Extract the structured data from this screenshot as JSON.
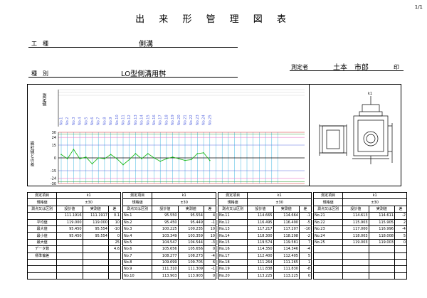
{
  "page_number": "1/1",
  "title": "出 来 形 管 理 図 表",
  "header": {
    "work_label": "工　種",
    "work_value": "側溝",
    "type_label": "種　別",
    "type_value": "LO型側溝用桝",
    "measurer_label": "測定者",
    "measurer_name": "土本　市郎",
    "seal_label": "印"
  },
  "chart": {
    "measured_label": "測定値",
    "diff_label": "設計値との差",
    "points": [
      "No.1",
      "No.2",
      "No.3",
      "No.4",
      "No.5",
      "No.6",
      "No.7",
      "No.8",
      "No.9",
      "No.10",
      "No.11",
      "No.12",
      "No.13",
      "No.14",
      "No.15",
      "No.16",
      "No.17",
      "No.18",
      "No.19",
      "No.20",
      "No.21",
      "No.22",
      "No.23",
      "No.24",
      "No.25"
    ],
    "ticks": [
      {
        "v": 30,
        "t": "30"
      },
      {
        "v": 24,
        "t": "24"
      },
      {
        "v": 15,
        "t": "15"
      },
      {
        "v": 0,
        "t": "0"
      },
      {
        "v": -15,
        "t": "-15"
      },
      {
        "v": -24,
        "t": "-24"
      },
      {
        "v": -30,
        "t": "-30"
      }
    ],
    "ylim": [
      -30,
      30
    ],
    "series": [
      4,
      -1,
      10,
      -1,
      1,
      -7,
      0,
      -1,
      4,
      -1,
      -8,
      -2,
      5,
      -1,
      5,
      0,
      -4,
      -1,
      1,
      -1,
      -3,
      -2,
      5,
      6,
      -3
    ],
    "colors": {
      "upper": "#d42020",
      "green": "#2a9a2a",
      "pink": "#e880c8",
      "blue": "#5a6ae0",
      "cyan": "#40b8e0",
      "zero": "#000000",
      "line": "#22bb22"
    }
  },
  "blocks": [
    {
      "item_label": "測定項目",
      "item_value": "k1",
      "std_label": "規格値",
      "std_value": "±30",
      "cols": [
        "測点又は区別",
        "設計値",
        "実測値",
        "差"
      ],
      "rows": [
        [
          "No.1",
          "95.550",
          "95.554",
          "4"
        ],
        [
          "No.2",
          "95.450",
          "95.449",
          "-1"
        ],
        [
          "No.3",
          "100.225",
          "100.235",
          "10"
        ],
        [
          "No.4",
          "103.349",
          "103.359",
          "10"
        ],
        [
          "No.5",
          "104.547",
          "104.544",
          "-3"
        ],
        [
          "No.6",
          "105.656",
          "105.656",
          "0"
        ],
        [
          "No.7",
          "108.277",
          "108.273",
          "-4"
        ],
        [
          "No.8",
          "109.699",
          "109.705",
          "6"
        ],
        [
          "No.9",
          "111.310",
          "111.309",
          "-1"
        ],
        [
          "No.10",
          "113.903",
          "113.903",
          "0"
        ]
      ]
    },
    {
      "item_label": "測定項目",
      "item_value": "k1",
      "std_label": "規格値",
      "std_value": "±30",
      "cols": [
        "測点又は区別",
        "設計値",
        "実測値",
        "差"
      ],
      "rows": [
        [
          "No.11",
          "114.665",
          "114.664",
          "-1"
        ],
        [
          "No.12",
          "116.495",
          "116.490",
          "-5"
        ],
        [
          "No.13",
          "117.217",
          "117.207",
          "-10"
        ],
        [
          "No.14",
          "118.300",
          "118.298",
          "-2"
        ],
        [
          "No.15",
          "119.574",
          "119.581",
          "7"
        ],
        [
          "No.16",
          "114.350",
          "114.346",
          "-4"
        ],
        [
          "No.17",
          "112.400",
          "112.405",
          "5"
        ],
        [
          "No.18",
          "111.264",
          "111.265",
          "1"
        ],
        [
          "No.19",
          "111.838",
          "111.830",
          "-8"
        ],
        [
          "No.20",
          "113.225",
          "113.225",
          "0"
        ]
      ]
    },
    {
      "item_label": "測定項目",
      "item_value": "k1",
      "std_label": "規格値",
      "std_value": "±30",
      "cols": [
        "測点又は区別",
        "設計値",
        "実測値",
        "差"
      ],
      "rows": [
        [
          "No.21",
          "114.613",
          "114.611",
          "-2"
        ],
        [
          "No.22",
          "115.903",
          "115.905",
          "2"
        ],
        [
          "No.23",
          "117.000",
          "116.996",
          "-4"
        ],
        [
          "No.24",
          "118.003",
          "118.008",
          "5"
        ],
        [
          "No.25",
          "119.003",
          "119.003",
          "0"
        ],
        [
          "",
          "",
          "",
          ""
        ],
        [
          "",
          "",
          "",
          ""
        ],
        [
          "",
          "",
          "",
          ""
        ],
        [
          "",
          "",
          "",
          ""
        ],
        [
          "",
          "",
          "",
          ""
        ]
      ]
    }
  ],
  "summary": {
    "label_header": "測点又は区別",
    "rows": [
      {
        "label": "",
        "a": "111.1916",
        "b": "111.1917",
        "c": "0.1"
      },
      {
        "label": "平均値",
        "a": "119.000",
        "b": "119.000",
        "c": "10"
      },
      {
        "label": "最大値",
        "a": "95.450",
        "b": "95.554",
        "c": "-10"
      },
      {
        "label": "最小値",
        "a": "95.450",
        "b": "95.554",
        "c": "0"
      },
      {
        "label": "最大値",
        "a": "",
        "b": "",
        "c": "25"
      },
      {
        "label": "データ数",
        "a": "",
        "b": "",
        "c": "4.6"
      },
      {
        "label": "標準偏差",
        "a": "",
        "b": "",
        "c": ""
      },
      {
        "label": "",
        "a": "",
        "b": "",
        "c": ""
      },
      {
        "label": "",
        "a": "",
        "b": "",
        "c": ""
      },
      {
        "label": "",
        "a": "",
        "b": "",
        "c": ""
      }
    ]
  }
}
